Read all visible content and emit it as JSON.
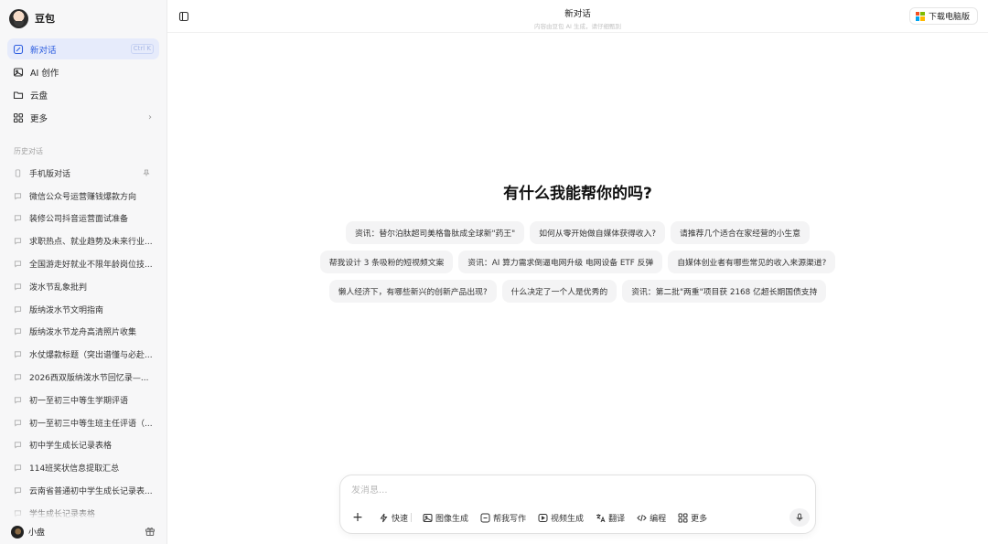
{
  "brand": {
    "name": "豆包"
  },
  "nav": [
    {
      "id": "new-chat",
      "label": "新对话",
      "icon": "edit-icon",
      "shortcut": "Ctrl K",
      "active": true
    },
    {
      "id": "ai-create",
      "label": "AI 创作",
      "icon": "image-icon"
    },
    {
      "id": "cloud",
      "label": "云盘",
      "icon": "folder-icon"
    },
    {
      "id": "more",
      "label": "更多",
      "icon": "grid-icon",
      "chevron": "›"
    }
  ],
  "history": {
    "title": "历史对话",
    "items": [
      {
        "label": "手机版对话",
        "pinned": true
      },
      {
        "label": "微信公众号运营赚钱爆款方向"
      },
      {
        "label": "装修公司抖音运营面试准备"
      },
      {
        "label": "求职热点、就业趋势及未来行业..."
      },
      {
        "label": "全国游走好就业不限年龄岗位技..."
      },
      {
        "label": "泼水节乱象批判"
      },
      {
        "label": "版纳泼水节文明指南"
      },
      {
        "label": "版纳泼水节龙舟高清照片收集"
      },
      {
        "label": "水仗爆款标题（突出谱懂与必赴..."
      },
      {
        "label": "2026西双版纳泼水节回忆录—..."
      },
      {
        "label": "初一至初三中等生学期评语"
      },
      {
        "label": "初一至初三中等生班主任评语（..."
      },
      {
        "label": "初中学生成长记录表格"
      },
      {
        "label": "114班奖状信息提取汇总"
      },
      {
        "label": "云南省普通初中学生成长记录表..."
      },
      {
        "label": "学生成长记录表格"
      }
    ]
  },
  "user": {
    "name": "小盘"
  },
  "topbar": {
    "title": "新对话",
    "subtitle": "内容由豆包 AI 生成，请仔细甄别",
    "download_label": "下载电脑版"
  },
  "headline": "有什么我能帮你的吗?",
  "suggestions": [
    [
      "资讯：替尔泊肽超司美格鲁肽成全球新\"药王\"",
      "如何从零开始做自媒体获得收入?",
      "请推荐几个适合在家经营的小生意"
    ],
    [
      "帮我设计 3 条吸粉的短视频文案",
      "资讯：AI 算力需求倒逼电网升级 电网设备 ETF 反弹",
      "自媒体创业者有哪些常见的收入来源渠道?"
    ],
    [
      "懒人经济下，有哪些新兴的创新产品出现?",
      "什么决定了一个人是优秀的",
      "资讯：第二批\"两重\"项目获 2168 亿超长期国债支持"
    ]
  ],
  "composer": {
    "placeholder": "发消息...",
    "plus": "+",
    "tools": [
      {
        "label": "快速",
        "icon": "bolt-icon"
      },
      {
        "label": "图像生成",
        "icon": "image-icon"
      },
      {
        "label": "帮我写作",
        "icon": "pen-icon"
      },
      {
        "label": "视频生成",
        "icon": "video-icon"
      },
      {
        "label": "翻译",
        "icon": "translate-icon"
      },
      {
        "label": "编程",
        "icon": "code-icon"
      },
      {
        "label": "更多",
        "icon": "grid-icon"
      }
    ]
  },
  "colors": {
    "accent": "#2f5fe0",
    "active_bg": "#e6ebfb",
    "sidebar_bg": "#f7f7f8",
    "chip_bg": "#f4f4f5",
    "ms_red": "#f25022",
    "ms_green": "#7fba00",
    "ms_blue": "#00a4ef",
    "ms_yellow": "#ffb900"
  }
}
